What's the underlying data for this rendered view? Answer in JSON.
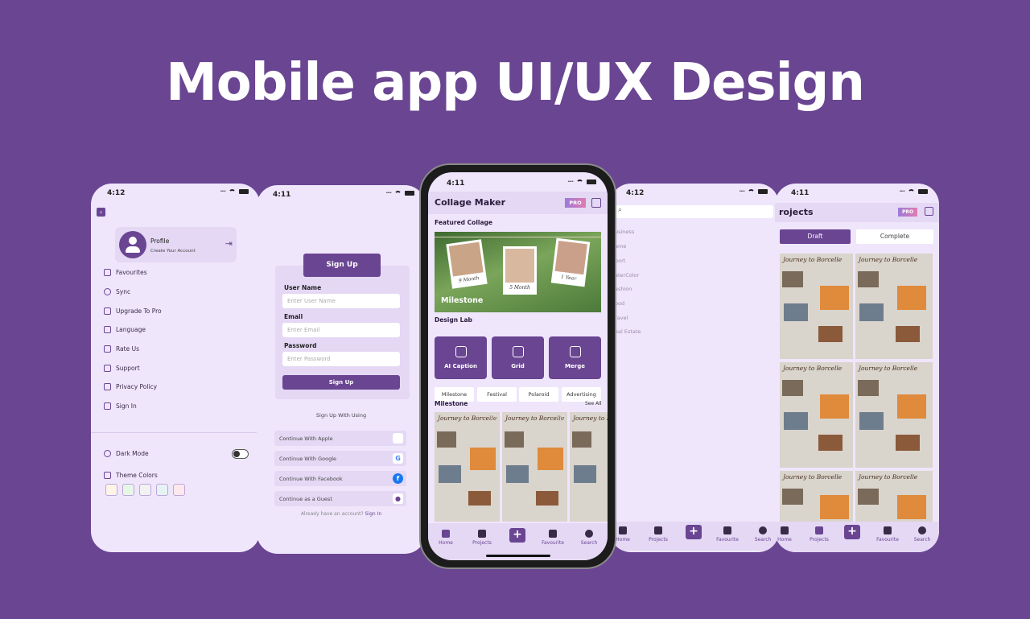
{
  "headline": "Mobile app UI/UX Design",
  "colors": {
    "brand": "#6a4592",
    "screen_bg": "#efe6fc",
    "panel": "#e4d8f4"
  },
  "screen1": {
    "time": "4:12",
    "profile_title": "Profile",
    "profile_sub": "Create Your Account",
    "menu": [
      "Favourites",
      "Sync",
      "Upgrade To Pro",
      "Language",
      "Rate Us",
      "Support",
      "Privacy Policy",
      "Sign In"
    ],
    "dark_mode": "Dark Mode",
    "theme_colors": "Theme Colors",
    "swatches": [
      "#fff4e8",
      "#e6f7e6",
      "#f2f2f2",
      "#e6f3f5",
      "#fde8ee"
    ]
  },
  "screen2": {
    "time": "4:11",
    "header_button": "Sign Up",
    "username_label": "User Name",
    "username_placeholder": "Enter User Name",
    "email_label": "Email",
    "email_placeholder": "Enter Email",
    "password_label": "Password",
    "password_placeholder": "Enter Password",
    "submit": "Sign Up",
    "signup_with": "Sign Up With Using",
    "socials": [
      {
        "label": "Continue With Apple",
        "icon": "apple-icon"
      },
      {
        "label": "Continue With Google",
        "icon": "google-icon"
      },
      {
        "label": "Continue With Facebook",
        "icon": "facebook-icon"
      },
      {
        "label": "Continue as a Guest",
        "icon": "user-icon"
      }
    ],
    "already": "Already have an account?",
    "signin": "Sign In"
  },
  "screen3": {
    "time": "4:11",
    "title": "Collage Maker",
    "pro": "PRO",
    "featured": "Featured Collage",
    "milestone_banner": "Milestone",
    "photo_captions": [
      "9 Month",
      "5 Month",
      "1 Year"
    ],
    "design_lab": "Design Lab",
    "design_cards": [
      "AI Caption",
      "Grid",
      "Merge"
    ],
    "chips": [
      "Milestone",
      "Festival",
      "Polaroid",
      "Advertising"
    ],
    "section": "Milestone",
    "see_all": "See All",
    "collage_title": "Journey to Borcelle",
    "nav": [
      "Home",
      "Projects",
      "Favourite",
      "Search"
    ]
  },
  "screen4": {
    "time": "4:12",
    "categories": [
      "usiness",
      "ame",
      "port",
      "aterColor",
      "ashion",
      "ood",
      "ravel",
      "eal Estate"
    ],
    "nav": [
      "Home",
      "Projects",
      "Favourite",
      "Search"
    ]
  },
  "screen5": {
    "time": "4:11",
    "title": "rojects",
    "pro": "PRO",
    "tabs": [
      "Draft",
      "Complete"
    ],
    "collage_title": "Journey to Borcelle",
    "nav": [
      "Home",
      "Projects",
      "Favourite",
      "Search"
    ]
  }
}
